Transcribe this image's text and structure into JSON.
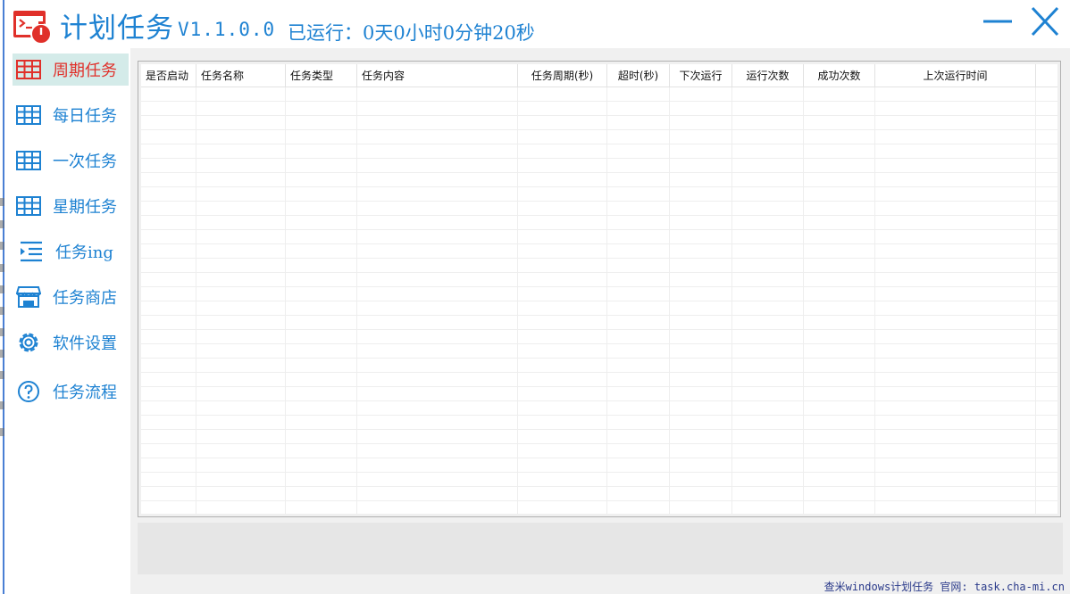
{
  "window": {
    "title": "计划任务",
    "version": "V1.1.0.0",
    "uptime": "已运行：0天0小时0分钟20秒",
    "minimize_icon": "minimize-icon",
    "close_icon": "close-icon",
    "accent_color": "#1e82d2",
    "active_color": "#e0302a",
    "active_bg": "#d4ebe9"
  },
  "sidebar": {
    "items": [
      {
        "label": "周期任务",
        "icon": "grid-table-icon",
        "active": true
      },
      {
        "label": "每日任务",
        "icon": "grid-table-icon",
        "active": false
      },
      {
        "label": "一次任务",
        "icon": "grid-table-icon",
        "active": false
      },
      {
        "label": "星期任务",
        "icon": "grid-table-icon",
        "active": false
      },
      {
        "label": "任务ing",
        "icon": "indent-list-icon",
        "active": false
      },
      {
        "label": "任务商店",
        "icon": "store-icon",
        "active": false
      },
      {
        "label": "软件设置",
        "icon": "gear-icon",
        "active": false
      },
      {
        "label": "任务流程",
        "icon": "help-circle-icon",
        "active": false
      }
    ]
  },
  "table": {
    "columns": [
      "是否启动",
      "任务名称",
      "任务类型",
      "任务内容",
      "任务周期(秒)",
      "超时(秒)",
      "下次运行",
      "运行次数",
      "成功次数",
      "上次运行时间"
    ],
    "rows": []
  },
  "footer": {
    "text": "查米windows计划任务 官网: task.cha-mi.cn"
  }
}
